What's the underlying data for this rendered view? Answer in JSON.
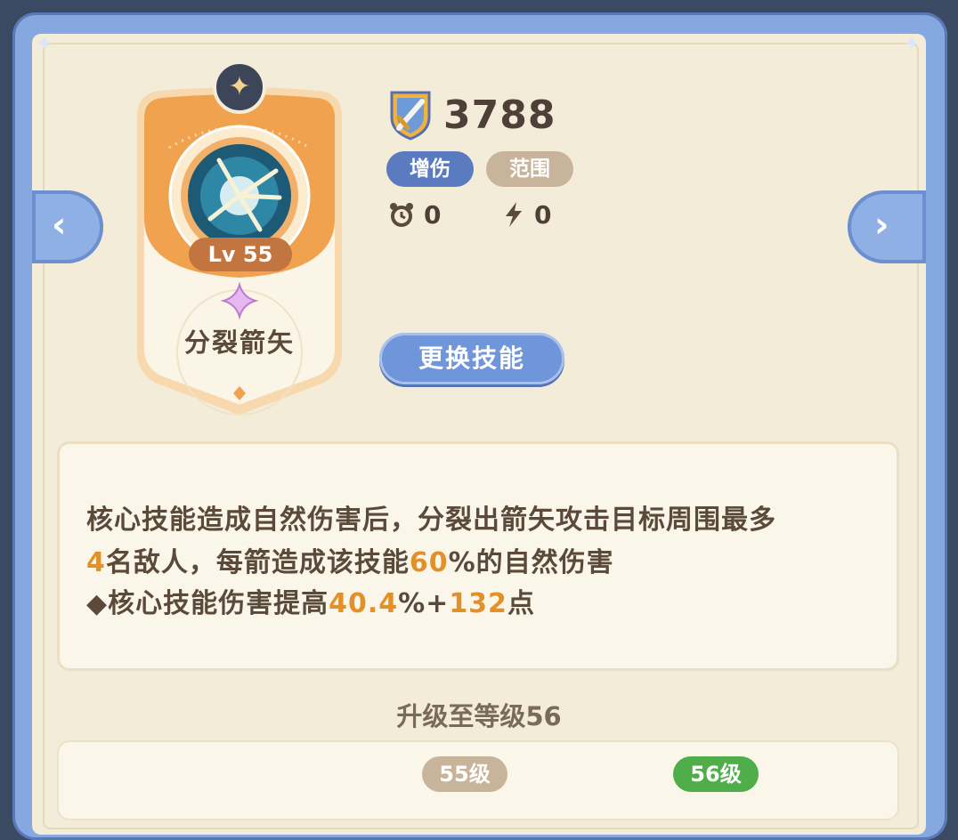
{
  "skill": {
    "name": "分裂箭矢",
    "level_label": "Lv 55"
  },
  "stats": {
    "power": "3788",
    "tags": [
      "增伤",
      "范围"
    ],
    "cooldown": "0",
    "energy": "0"
  },
  "buttons": {
    "swap_skill": "更换技能",
    "prev": "‹",
    "next": "›"
  },
  "description": {
    "line1": "核心技能造成自然伤害后，分裂出箭矢攻击目标周围最多",
    "line2_count": "4",
    "line2_mid": "名敌人，每箭造成该技能",
    "line2_pct": "60",
    "line2_end": "%的自然伤害",
    "line3_prefix": "◆核心技能伤害提高",
    "line3_pct": "40.4",
    "line3_mid": "%+",
    "line3_flat": "132",
    "line3_end": "点"
  },
  "upgrade": {
    "title": "升级至等级56",
    "current_level": "55级",
    "next_level": "56级"
  },
  "colors": {
    "highlight": "#e2902a",
    "tag_damage": "#5a7bc0",
    "tag_range": "#c8b49a",
    "next_level": "#4fae4a",
    "card_orange": "#f0a24f"
  },
  "icons": [
    "compass-star-icon",
    "arrow-burst-skill-icon",
    "sword-shield-icon",
    "alarm-clock-icon",
    "lightning-icon",
    "purple-sparkle-icon"
  ]
}
